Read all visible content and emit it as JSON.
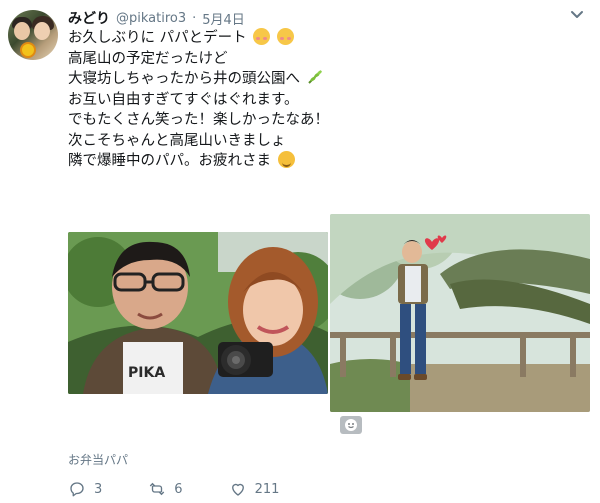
{
  "tweet": {
    "display_name": "みどり",
    "handle": "@pikatiro3",
    "separator": "·",
    "date": "5月4日",
    "lines": [
      "お久しぶりに パパとデート",
      "高尾山の予定だったけど",
      "大寝坊しちゃったから井の頭公園へ",
      "お互い自由すぎてすぐはぐれます。",
      "でもたくさん笑った！楽しかったなあ！",
      "次こそちゃんと高尾山いきましょ",
      "隣で爆睡中のパパ。お疲れさま"
    ],
    "location": "お弁当パパ",
    "reply_count": "3",
    "retweet_count": "6",
    "like_count": "211"
  },
  "icons": {
    "more": "chevron-down-icon",
    "reply": "reply-icon",
    "retweet": "retweet-icon",
    "like": "heart-icon",
    "media_badge": "gif-icon"
  },
  "colors": {
    "text": "#14171a",
    "muted": "#657786",
    "accent": "#e0245e"
  }
}
